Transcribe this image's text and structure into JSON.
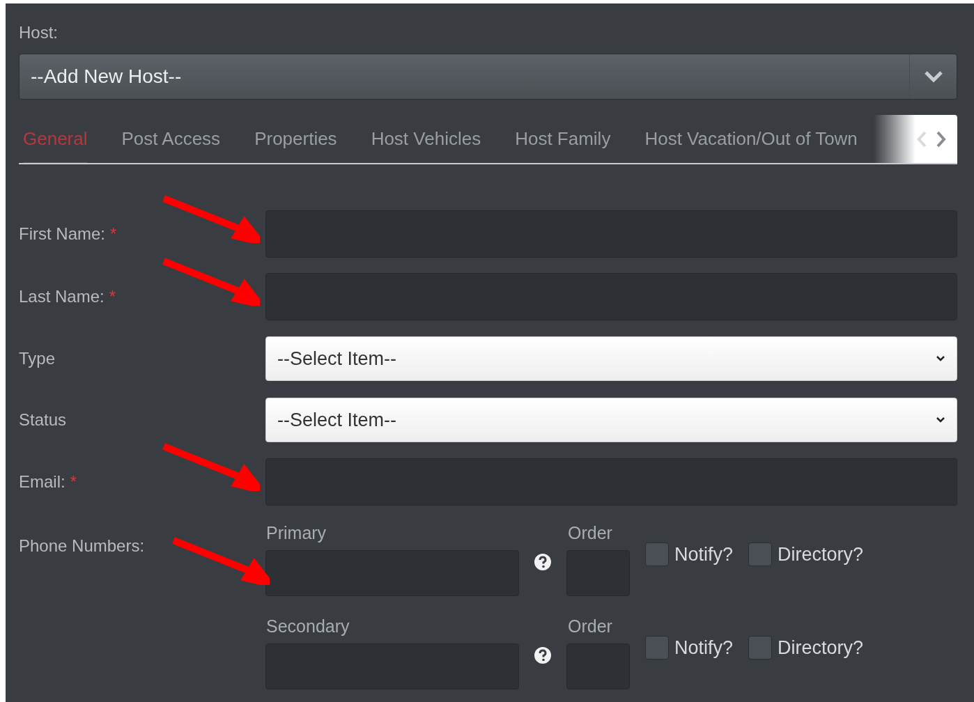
{
  "host": {
    "label": "Host:",
    "value": "--Add New Host--"
  },
  "tabs": [
    {
      "label": "General",
      "selected": true
    },
    {
      "label": "Post Access",
      "selected": false
    },
    {
      "label": "Properties",
      "selected": false
    },
    {
      "label": "Host Vehicles",
      "selected": false
    },
    {
      "label": "Host Family",
      "selected": false
    },
    {
      "label": "Host Vacation/Out of Town",
      "selected": false
    }
  ],
  "fields": [
    {
      "kind": "text",
      "label": "First Name:",
      "required_mark": "*",
      "arrow": true
    },
    {
      "kind": "text",
      "label": "Last Name:",
      "required_mark": "*",
      "arrow": true
    },
    {
      "kind": "select",
      "label": "Type",
      "arrow": false,
      "value": "--Select Item--"
    },
    {
      "kind": "select",
      "label": "Status",
      "arrow": false,
      "value": "--Select Item--"
    },
    {
      "kind": "text",
      "label": "Email:",
      "required_mark": "*",
      "arrow": true
    }
  ],
  "phones": {
    "label": "Phone Numbers:",
    "arrow": true,
    "rows": [
      {
        "label": "Primary",
        "order_label": "Order",
        "notify": {
          "label": "Notify?",
          "checked": false
        },
        "directory": {
          "label": "Directory?",
          "checked": false
        }
      },
      {
        "label": "Secondary",
        "order_label": "Order",
        "notify": {
          "label": "Notify?",
          "checked": false
        },
        "directory": {
          "label": "Directory?",
          "checked": false
        }
      }
    ]
  }
}
